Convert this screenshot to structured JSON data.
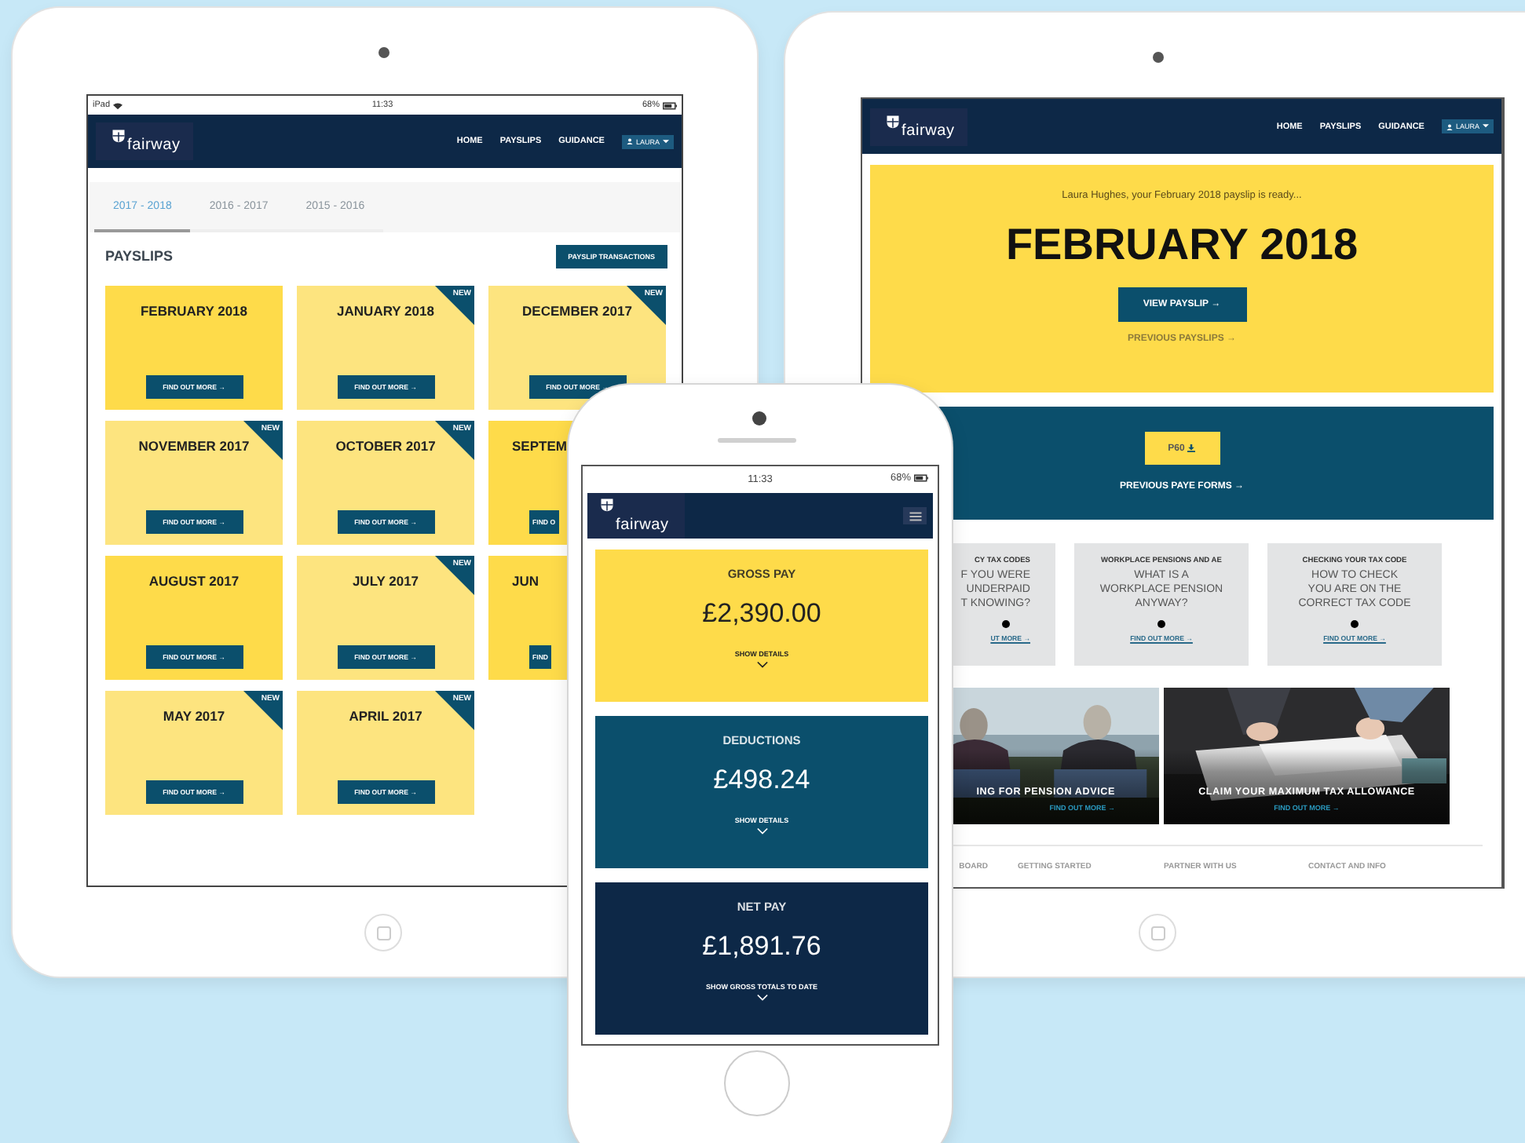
{
  "left_tablet": {
    "status_bar": {
      "device": "iPad",
      "time": "11:33",
      "battery": "68%"
    },
    "nav": {
      "logo": "fairway",
      "items": [
        "HOME",
        "PAYSLIPS",
        "GUIDANCE"
      ],
      "user": "LAURA"
    },
    "tabs": [
      {
        "label": "2017 - 2018",
        "selected": true
      },
      {
        "label": "2016 - 2017",
        "selected": false
      },
      {
        "label": "2015 - 2016",
        "selected": false
      }
    ],
    "heading": "PAYSLIPS",
    "action": "PAYSLIP TRANSACTIONS",
    "payslips": [
      {
        "month": "FEBRUARY 2018",
        "button": "FIND OUT MORE →"
      },
      {
        "month": "JANUARY 2018",
        "badge": "NEW",
        "button": "FIND OUT MORE →"
      },
      {
        "month": "DECEMBER 2017",
        "badge": "NEW",
        "button": "FIND OUT MORE →"
      },
      {
        "month": "NOVEMBER 2017",
        "badge": "NEW",
        "button": "FIND OUT MORE →"
      },
      {
        "month": "OCTOBER 2017",
        "badge": "NEW",
        "button": "FIND OUT MORE →"
      },
      {
        "month": "SEPTEM",
        "button": "FIND O"
      },
      {
        "month": "AUGUST 2017",
        "button": "FIND OUT MORE →"
      },
      {
        "month": "JULY 2017",
        "badge": "NEW",
        "button": "FIND OUT MORE →"
      },
      {
        "month": "JUN",
        "button": "FIND"
      },
      {
        "month": "MAY 2017",
        "badge": "NEW",
        "button": "FIND OUT MORE →"
      },
      {
        "month": "APRIL 2017",
        "badge": "NEW",
        "button": "FIND OUT MORE →"
      }
    ]
  },
  "right_tablet": {
    "nav": {
      "logo": "fairway",
      "items": [
        "HOME",
        "PAYSLIPS",
        "GUIDANCE"
      ],
      "user": "LAURA"
    },
    "hero": {
      "greeting": "Laura Hughes, your February 2018 payslip is ready...",
      "title": "FEBRUARY 2018",
      "button": "VIEW PAYSLIP →",
      "link": "PREVIOUS PAYSLIPS →"
    },
    "forms": {
      "button": "P60",
      "link": "PREVIOUS PAYE FORMS →"
    },
    "guides": [
      {
        "category": "CY TAX CODES",
        "lines": [
          "F YOU WERE",
          "UNDERPAID",
          "T KNOWING?"
        ],
        "link": "UT MORE →"
      },
      {
        "category": "WORKPLACE PENSIONS AND AE",
        "lines": [
          "WHAT IS A",
          "WORKPLACE PENSION",
          "ANYWAY?"
        ],
        "link": "FIND OUT MORE →"
      },
      {
        "category": "CHECKING YOUR TAX CODE",
        "lines": [
          "HOW TO CHECK",
          "YOU ARE ON THE",
          "CORRECT TAX CODE"
        ],
        "link": "FIND OUT MORE →"
      }
    ],
    "features": [
      {
        "kind": "beach",
        "title": "ING FOR PENSION ADVICE",
        "link": "FIND OUT MORE →"
      },
      {
        "kind": "desk",
        "title": "CLAIM YOUR MAXIMUM TAX ALLOWANCE",
        "link": "FIND OUT MORE →"
      }
    ],
    "footer_columns": [
      "BOARD",
      "GETTING STARTED",
      "PARTNER WITH US",
      "CONTACT AND INFO"
    ]
  },
  "phone": {
    "status_bar": {
      "time": "11:33",
      "battery": "68%"
    },
    "nav": {
      "logo": "fairway"
    },
    "cards": [
      {
        "color": "#fedb4a",
        "label": "GROSS PAY",
        "amount": "£2,390.00",
        "toggle": "SHOW DETAILS"
      },
      {
        "color": "#0b4f6c",
        "label": "DEDUCTIONS",
        "amount": "£498.24",
        "toggle": "SHOW DETAILS"
      },
      {
        "color": "#0d2847",
        "label": "NET PAY",
        "amount": "£1,891.76",
        "toggle": "SHOW GROSS TOTALS TO DATE"
      }
    ]
  }
}
